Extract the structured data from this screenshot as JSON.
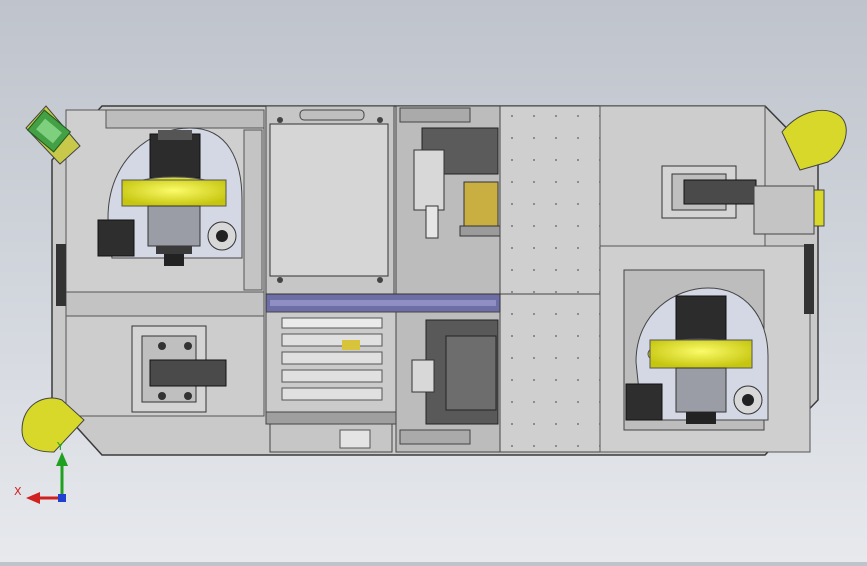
{
  "viewport": {
    "background_top": "#bfc4cc",
    "background_bottom": "#e7e9ed"
  },
  "model": {
    "chassis_color": "#c8c8c8",
    "panel_color": "#d2d2d2",
    "line_color": "#3c3c3c",
    "wheel_yellow": "#e6e61e",
    "bumper_yellow": "#d8d82a",
    "green_sensor": "#44a044",
    "rail_color": "#6e6ea6",
    "dark_part": "#505050"
  },
  "triad": {
    "x_label": "X",
    "y_label": "Y",
    "x_color": "#d02020",
    "y_color": "#20a020",
    "z_color": "#2040d0"
  }
}
